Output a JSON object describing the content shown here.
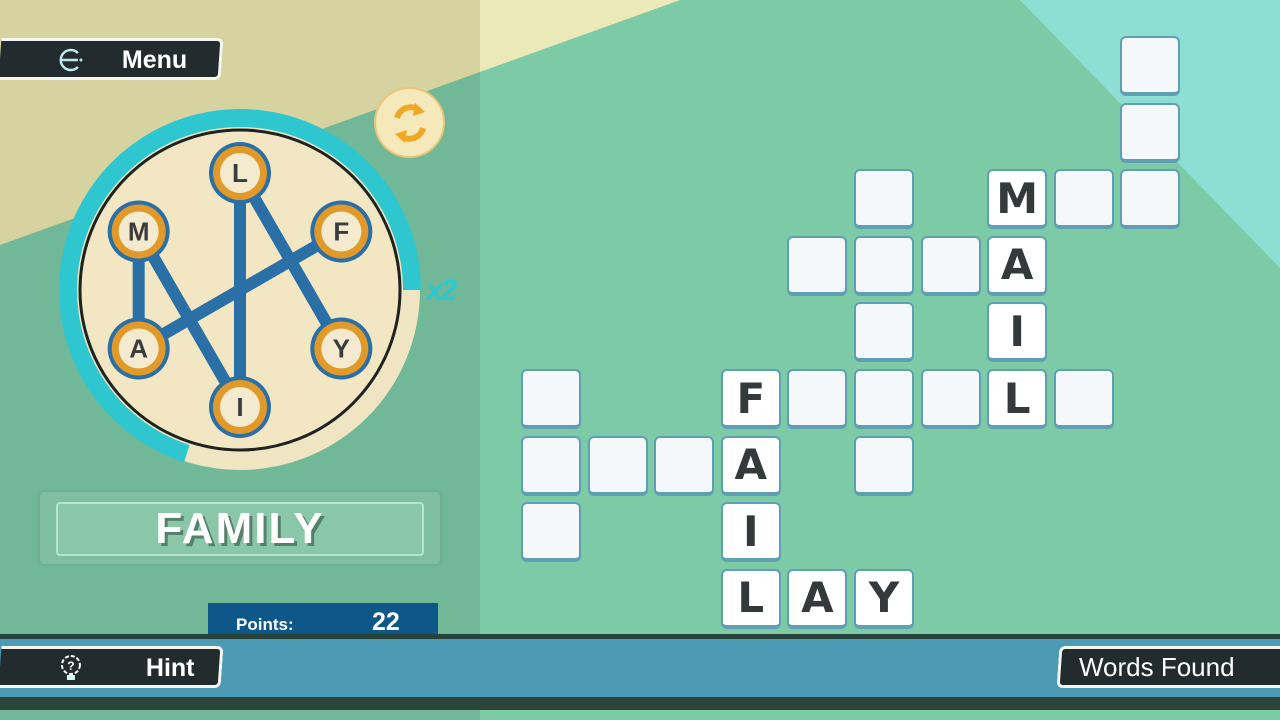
{
  "header": {
    "menu_label": "Menu",
    "menu_icon": "exit-icon"
  },
  "wheel": {
    "letters": [
      "L",
      "F",
      "Y",
      "I",
      "A",
      "M"
    ],
    "connections": [
      [
        "M",
        "A"
      ],
      [
        "M",
        "I"
      ],
      [
        "L",
        "I"
      ],
      [
        "L",
        "Y"
      ],
      [
        "A",
        "F"
      ]
    ],
    "multiplier": "x2",
    "shuffle_icon": "shuffle-arrows-icon",
    "progress_fraction": 0.7
  },
  "current_word": "FAMILY",
  "points": {
    "label": "Points:",
    "value": "22"
  },
  "footer": {
    "hint_label": "Hint",
    "hint_icon": "lightbulb-question-icon",
    "words_found_label": "Words Found"
  },
  "grid": [
    ".........#",
    ".........#",
    ".....#.M##",
    "....###A..",
    ".....#.I..",
    "#..F###L#.",
    "###A.#....",
    "#..I......",
    "...LAY...."
  ],
  "colors": {
    "accent": "#2ec6cf",
    "node": "#e19a2a",
    "line": "#2a6fa5",
    "bar": "#4d9ab5",
    "points_bg": "#0d5888"
  }
}
